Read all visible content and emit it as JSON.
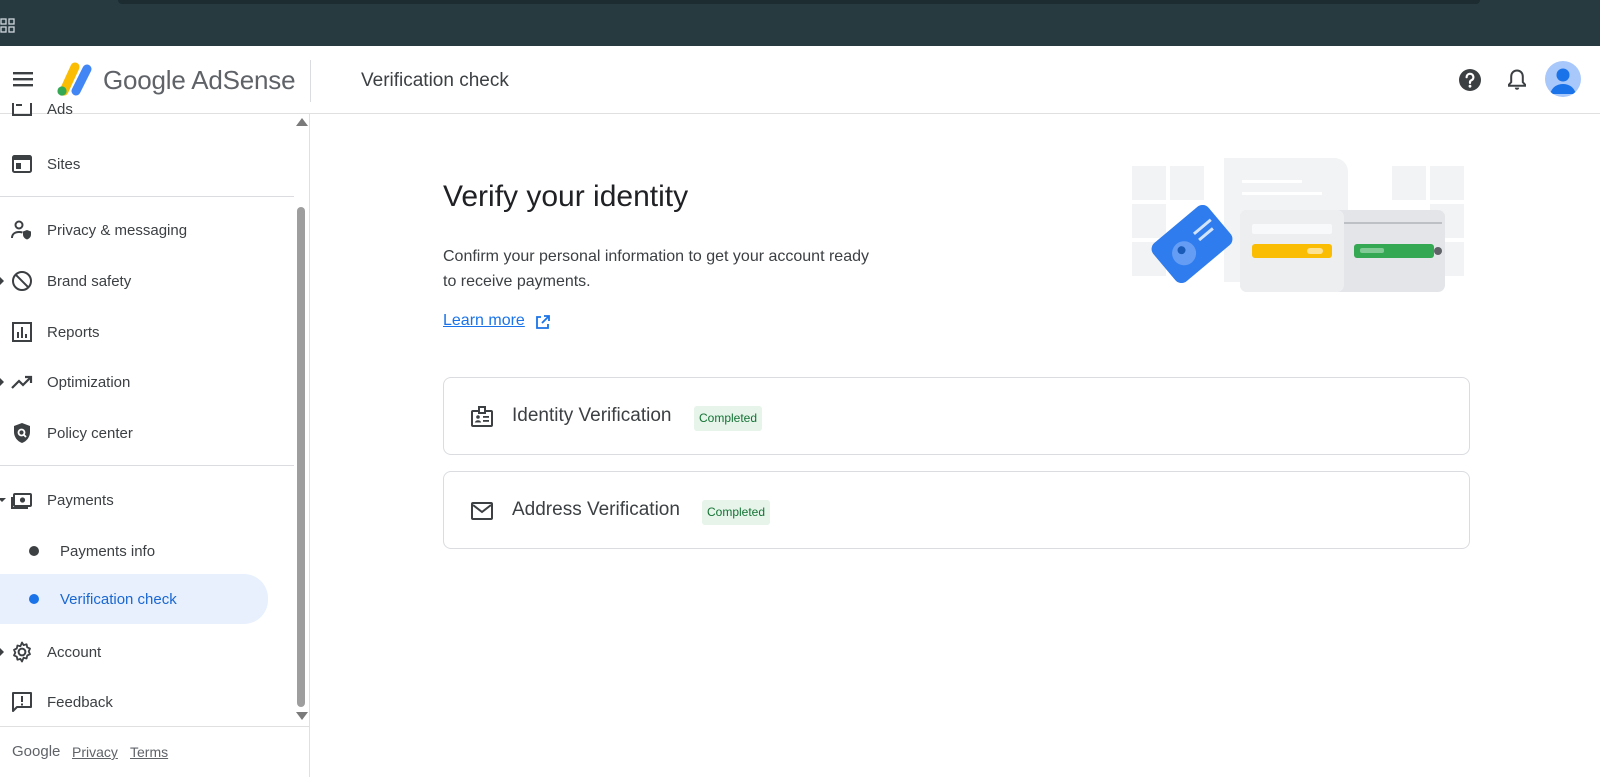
{
  "header": {
    "brand": "Google AdSense",
    "page_title": "Verification check"
  },
  "sidebar": {
    "items": [
      {
        "label": "Ads",
        "icon": "ads-icon"
      },
      {
        "label": "Sites",
        "icon": "sites-icon"
      },
      {
        "label": "Privacy & messaging",
        "icon": "privacy-icon"
      },
      {
        "label": "Brand safety",
        "icon": "block-icon"
      },
      {
        "label": "Reports",
        "icon": "reports-icon"
      },
      {
        "label": "Optimization",
        "icon": "trending-up-icon"
      },
      {
        "label": "Policy center",
        "icon": "policy-shield-icon"
      },
      {
        "label": "Payments",
        "icon": "payments-icon"
      },
      {
        "label": "Payments info",
        "icon": "dot"
      },
      {
        "label": "Verification check",
        "icon": "dot"
      },
      {
        "label": "Account",
        "icon": "gear-icon"
      },
      {
        "label": "Feedback",
        "icon": "feedback-icon"
      }
    ],
    "footer": {
      "google": "Google",
      "privacy": "Privacy",
      "terms": "Terms"
    }
  },
  "main": {
    "title": "Verify your identity",
    "description": "Confirm your personal information to get your account ready to receive payments.",
    "learn_more": "Learn more",
    "cards": [
      {
        "title": "Identity Verification",
        "status": "Completed",
        "icon": "id-badge-icon"
      },
      {
        "title": "Address Verification",
        "status": "Completed",
        "icon": "mail-icon"
      }
    ]
  },
  "colors": {
    "accent": "#1a73e8",
    "active_bg": "#e8f0fe",
    "badge_bg": "#e6f4ea",
    "badge_text": "#137333",
    "os_bar": "#263a40"
  }
}
